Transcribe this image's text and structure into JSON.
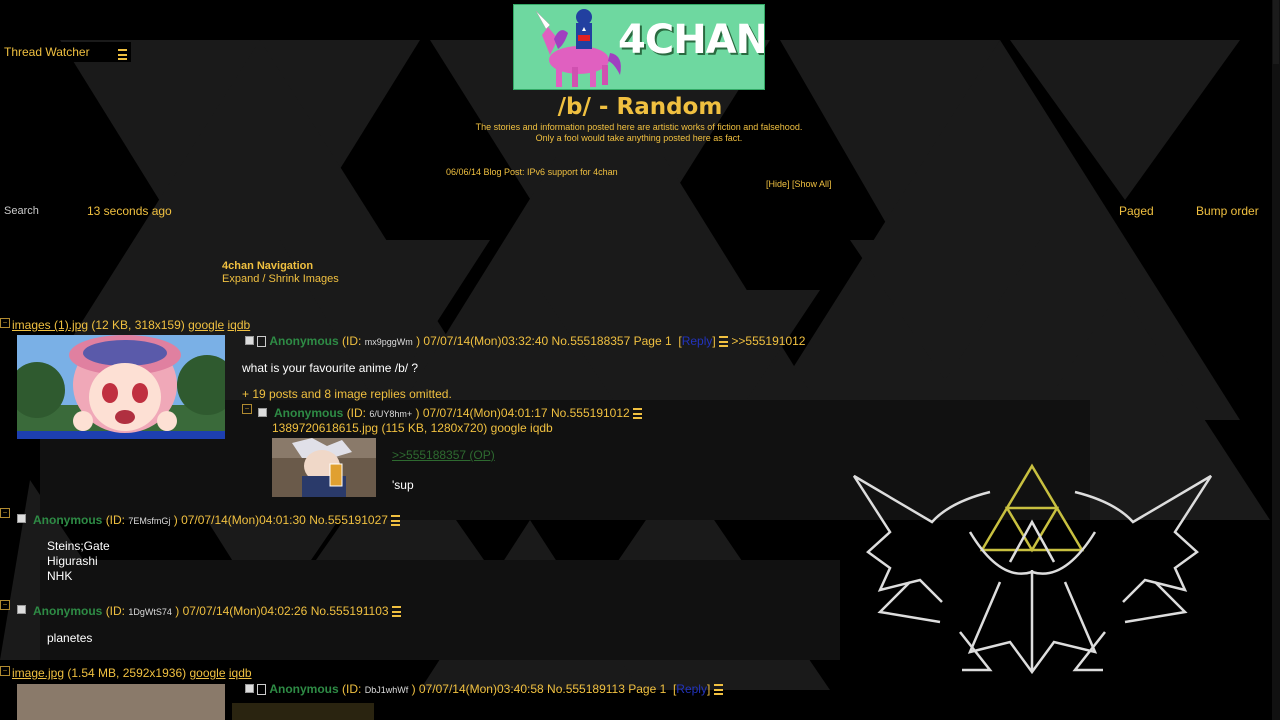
{
  "thread_watcher": {
    "label": "Thread Watcher"
  },
  "banner": {
    "logo_text": "4CHAN"
  },
  "board": {
    "title": "/b/ - Random",
    "subtitle_line1": "The stories and information posted here are artistic works of fiction and falsehood.",
    "subtitle_line2": "Only a fool would take anything posted here as fact."
  },
  "blog": {
    "text": "06/06/14 Blog Post: IPv6 support for 4chan"
  },
  "hide_links": {
    "hide": "[Hide]",
    "show_all": "[Show All]"
  },
  "toolbar": {
    "search_label": "Search",
    "updated": "13 seconds ago",
    "paged": "Paged",
    "bump_order": "Bump order"
  },
  "nav": {
    "title": "4chan Navigation",
    "expand_shrink": "Expand / Shrink Images"
  },
  "threads": [
    {
      "file_name": "images (1).jpg",
      "file_info": "(12 KB, 318x159)",
      "google": "google",
      "iqdb": "iqdb",
      "name": "Anonymous",
      "id_prefix": "(ID:",
      "id": "mx9pggWm",
      "id_suffix": ")",
      "date": "07/07/14(Mon)03:32:40",
      "no": "No.555188357",
      "page": "Page 1",
      "reply": "Reply",
      "backlink": ">>555191012",
      "comment": "what is your favourite anime /b/ ?",
      "omitted": "+ 19 posts and 8 image replies omitted."
    },
    {
      "file_name": "image.jpg",
      "file_info": "(1.54 MB, 2592x1936)",
      "google": "google",
      "iqdb": "iqdb",
      "name": "Anonymous",
      "id_prefix": "(ID:",
      "id": "DbJ1whWf",
      "id_suffix": ")",
      "date": "07/07/14(Mon)03:40:58",
      "no": "No.555189113",
      "page": "Page 1",
      "reply": "Reply"
    }
  ],
  "replies": [
    {
      "name": "Anonymous",
      "id_prefix": "(ID:",
      "id": "6/UY8hm+",
      "id_suffix": ")",
      "date": "07/07/14(Mon)04:01:17",
      "no": "No.555191012",
      "file_name": "1389720618615.jpg",
      "file_info": "(115 KB, 1280x720)",
      "google": "google",
      "iqdb": "iqdb",
      "quotelink": ">>555188357 (OP)",
      "comment": "'sup"
    },
    {
      "name": "Anonymous",
      "id_prefix": "(ID:",
      "id": "7EMsfmGj",
      "id_suffix": ")",
      "date": "07/07/14(Mon)04:01:30",
      "no": "No.555191027",
      "comment_lines": [
        "Steins;Gate",
        "Higurashi",
        "NHK"
      ]
    },
    {
      "name": "Anonymous",
      "id_prefix": "(ID:",
      "id": "1DgWtS74",
      "id_suffix": ")",
      "date": "07/07/14(Mon)04:02:26",
      "no": "No.555191103",
      "comment": "planetes"
    }
  ],
  "colors": {
    "background": "#000000",
    "text": "#f0c040",
    "name_green": "#2e8b45",
    "reply_blue": "#2233bb",
    "banner_bg": "#6ed8a0"
  }
}
